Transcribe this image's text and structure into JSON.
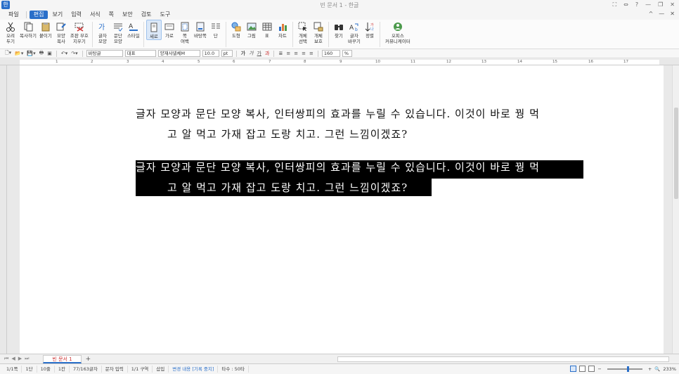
{
  "window": {
    "title": "빈 문서 1 - 한글",
    "controls": [
      "⛶",
      "⇔",
      "?",
      "—",
      "❐",
      "✕"
    ]
  },
  "menu": {
    "items": [
      {
        "label": "파일",
        "active": false
      },
      {
        "label": "편집",
        "active": true
      },
      {
        "label": "보기",
        "active": false
      },
      {
        "label": "입력",
        "active": false
      },
      {
        "label": "서식",
        "active": false
      },
      {
        "label": "쪽",
        "active": false
      },
      {
        "label": "보안",
        "active": false
      },
      {
        "label": "검토",
        "active": false
      },
      {
        "label": "도구",
        "active": false
      }
    ],
    "right_controls": [
      "^",
      "—",
      "✕"
    ]
  },
  "ribbon": {
    "cut": "오려\n두기",
    "copy": "복사하기",
    "paste": "붙이기",
    "format_copy": "모양\n복사",
    "paste_special": "조판 부호\n지우기",
    "char_shape": "글자\n모양",
    "para_shape": "문단\n모양",
    "style": "스타일",
    "vertical": "세로",
    "horizontal": "가로",
    "page_margin": "쪽\n여백",
    "background": "바탕쪽",
    "columns": "단",
    "shape": "도형",
    "picture": "그림",
    "table": "표",
    "chart": "차트",
    "object_select": "개체\n선택",
    "object_protect": "개체\n보호",
    "find": "찾기",
    "char_change": "글자\n바꾸기",
    "sort": "정렬",
    "office_comm": "오피스\n커뮤니케이터"
  },
  "format_toolbar": {
    "style_name": "바탕글",
    "lang": "대표",
    "font": "양재샤넬체M",
    "size": "10.0",
    "unit": "pt",
    "bold": "가",
    "italic": "가",
    "underline": "가",
    "strike": "과",
    "zoom": "160",
    "zoom_unit": "%"
  },
  "ruler": {
    "ticks": [
      "1",
      "2",
      "3",
      "4",
      "5",
      "6",
      "7",
      "8",
      "9",
      "10",
      "11",
      "12",
      "13",
      "14",
      "15",
      "16",
      "17"
    ]
  },
  "document": {
    "para1_line1": "글자 모양과 문단 모양 복사, 인터쌍피의 효과를 누릴 수 있습니다. 이것이 바로 꿩 먹",
    "para1_line2": "고 알 먹고 가재 잡고 도랑 치고. 그런 느낌이겠죠?",
    "para2_line1": "글자 모양과 문단 모양 복사, 인터쌍피의 효과를 누릴 수 있습니다. 이것이 바로 꿩 먹",
    "para2_line2": "고 알 먹고 가재 잡고 도랑 치고. 그런 느낌이겠죠?"
  },
  "tabs": {
    "doc_tab": "빈 문서 1",
    "add": "+"
  },
  "status": {
    "page": "1/1쪽",
    "section": "1단",
    "line": "10줄",
    "column": "1칸",
    "chars": "77/163글자",
    "input_mode": "문자 입력",
    "zone": "1/1 구역",
    "insert": "삽입",
    "track": "변경 내용 [기록 중지]",
    "typing": "타수 : 50타",
    "zoom": "233%"
  },
  "colors": {
    "accent": "#2a6fc9",
    "selection": "#000000"
  }
}
